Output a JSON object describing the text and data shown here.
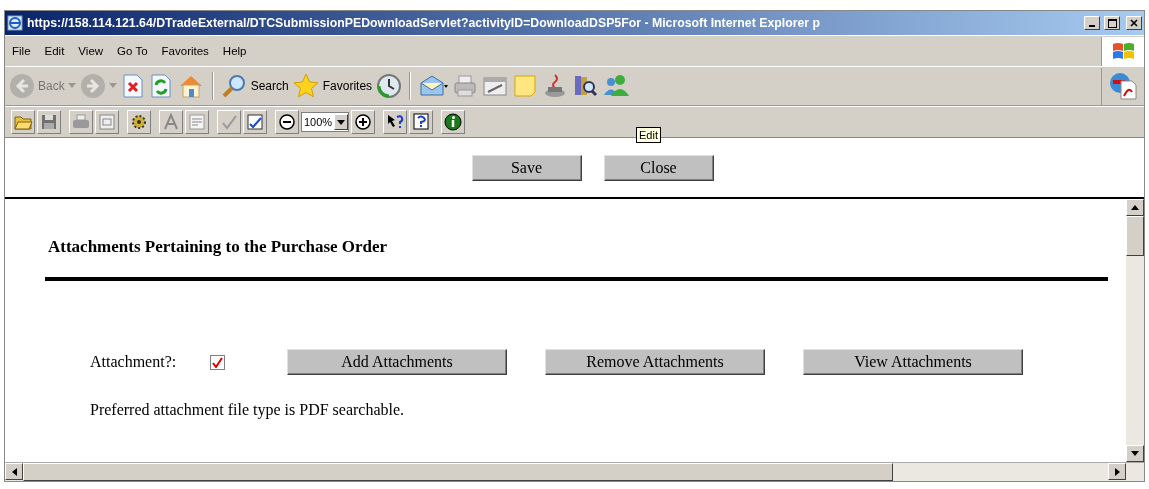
{
  "window": {
    "title": "https://158.114.121.64/DTradeExternal/DTCSubmissionPEDownloadServlet?activityID=DownloadDSP5For - Microsoft Internet Explorer p"
  },
  "menu": [
    "File",
    "Edit",
    "View",
    "Go To",
    "Favorites",
    "Help"
  ],
  "toolbar": {
    "back": {
      "label": "Back",
      "disabled": true
    },
    "forward": {
      "disabled": true
    },
    "search": "Search",
    "favorites": "Favorites"
  },
  "edit_toolbar": {
    "zoom": "100%"
  },
  "tooltip": "Edit",
  "top_buttons": [
    "Save",
    "Close"
  ],
  "page": {
    "heading": "Attachments Pertaining to the Purchase Order",
    "attachment": {
      "label": "Attachment?:",
      "checked": true
    },
    "buttons": [
      "Add Attachments",
      "Remove Attachments",
      "View Attachments"
    ],
    "note": "Preferred attachment file type is PDF searchable."
  }
}
